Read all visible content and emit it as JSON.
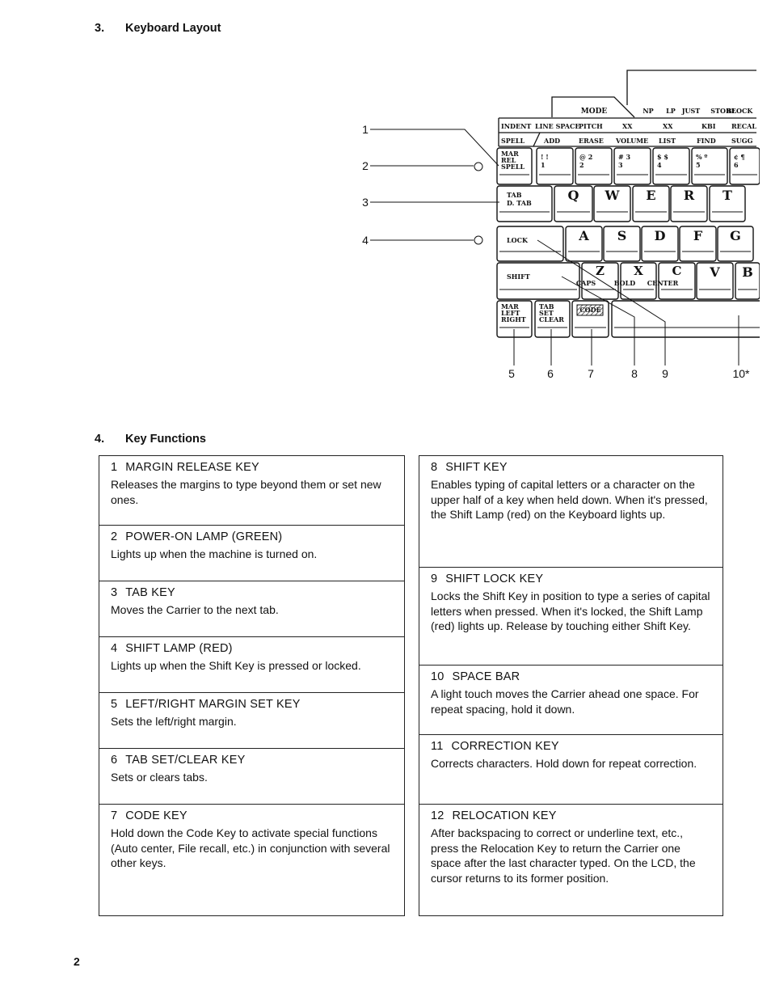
{
  "section3": {
    "number": "3.",
    "title": "Keyboard Layout"
  },
  "section4": {
    "number": "4.",
    "title": "Key Functions"
  },
  "keyboard": {
    "mode_label": "MODE",
    "top_labels": [
      "NP",
      "LP",
      "JUST",
      "STORE",
      "BLOCK"
    ],
    "row_indent": [
      "INDENT",
      "LINE SPACE",
      "PITCH",
      "XX",
      "XX",
      "KBI",
      "RECAL"
    ],
    "row_spell": [
      "SPELL",
      "ADD",
      "ERASE",
      "VOLUME",
      "LIST",
      "FIND",
      "SUGG"
    ],
    "keys": [
      {
        "id": "mar-rel-spell",
        "lines": [
          "MAR",
          "REL",
          "SPELL"
        ]
      },
      {
        "id": "1",
        "lines": [
          "!  !",
          "1"
        ]
      },
      {
        "id": "2",
        "lines": [
          "@  2",
          "2"
        ]
      },
      {
        "id": "3",
        "lines": [
          "#  3",
          "3"
        ]
      },
      {
        "id": "4",
        "lines": [
          "$  $",
          "4"
        ]
      },
      {
        "id": "5",
        "lines": [
          "%  º",
          "5"
        ]
      },
      {
        "id": "6",
        "lines": [
          "¢  ¶",
          "6"
        ]
      },
      {
        "id": "tab",
        "lines": [
          "TAB",
          "D. TAB"
        ]
      },
      {
        "id": "q",
        "lines": [
          "Q"
        ]
      },
      {
        "id": "w",
        "lines": [
          "W"
        ]
      },
      {
        "id": "e",
        "lines": [
          "E"
        ]
      },
      {
        "id": "r",
        "lines": [
          "R"
        ]
      },
      {
        "id": "t",
        "lines": [
          "T"
        ]
      },
      {
        "id": "lock",
        "lines": [
          "LOCK"
        ]
      },
      {
        "id": "a",
        "lines": [
          "A"
        ]
      },
      {
        "id": "s",
        "lines": [
          "S"
        ]
      },
      {
        "id": "d",
        "lines": [
          "D"
        ]
      },
      {
        "id": "f",
        "lines": [
          "F"
        ]
      },
      {
        "id": "g",
        "lines": [
          "G"
        ]
      },
      {
        "id": "shift",
        "lines": [
          "SHIFT"
        ]
      },
      {
        "id": "z",
        "lines": [
          "Z",
          "CAPS"
        ]
      },
      {
        "id": "x",
        "lines": [
          "X",
          "BOLD"
        ]
      },
      {
        "id": "c",
        "lines": [
          "C",
          "CENTER"
        ]
      },
      {
        "id": "v",
        "lines": [
          "V"
        ]
      },
      {
        "id": "b",
        "lines": [
          "B"
        ]
      },
      {
        "id": "mar-left-right",
        "lines": [
          "MAR",
          "LEFT",
          "RIGHT"
        ]
      },
      {
        "id": "tab-set-clear",
        "lines": [
          "TAB",
          "SET",
          "CLEAR"
        ]
      },
      {
        "id": "code",
        "lines": [
          "CODE"
        ]
      },
      {
        "id": "space",
        "lines": []
      }
    ],
    "callouts": [
      "1",
      "2",
      "3",
      "4",
      "5",
      "6",
      "7",
      "8",
      "9",
      "10*"
    ]
  },
  "functions_left": [
    {
      "n": "1",
      "title": "MARGIN RELEASE KEY",
      "desc": "Releases the margins to type beyond them or set new ones."
    },
    {
      "n": "2",
      "title": "POWER-ON LAMP (GREEN)",
      "desc": "Lights up when the machine is turned on."
    },
    {
      "n": "3",
      "title": "TAB KEY",
      "desc": "Moves the Carrier to the next tab."
    },
    {
      "n": "4",
      "title": "SHIFT LAMP (RED)",
      "desc": "Lights up when the Shift Key is pressed or locked."
    },
    {
      "n": "5",
      "title": "LEFT/RIGHT MARGIN SET KEY",
      "desc": "Sets the left/right margin."
    },
    {
      "n": "6",
      "title": "TAB SET/CLEAR KEY",
      "desc": "Sets or clears tabs."
    },
    {
      "n": "7",
      "title": "CODE KEY",
      "desc": "Hold down the Code Key to activate special functions (Auto center, File recall, etc.) in conjunction with several other keys."
    }
  ],
  "functions_right": [
    {
      "n": "8",
      "title": "SHIFT KEY",
      "desc": "Enables typing of capital letters or a character on the upper half of a key when held down. When it's pressed, the Shift Lamp (red) on the Keyboard lights up."
    },
    {
      "n": "9",
      "title": "SHIFT LOCK KEY",
      "desc": "Locks the Shift Key in position to type a series of capital letters when pressed. When it's locked, the Shift Lamp (red) lights up. Release by touching either Shift Key."
    },
    {
      "n": "10",
      "title": "SPACE BAR",
      "desc": "A light touch moves the Carrier ahead one space. For repeat spacing, hold it down."
    },
    {
      "n": "11",
      "title": "CORRECTION KEY",
      "desc": "Corrects characters. Hold down for repeat correction."
    },
    {
      "n": "12",
      "title": "RELOCATION KEY",
      "desc": "After backspacing to correct or underline text, etc., press the Relocation Key to return the Carrier one space after the last character typed. On the LCD, the cursor returns to its former position."
    }
  ],
  "page_number": "2"
}
